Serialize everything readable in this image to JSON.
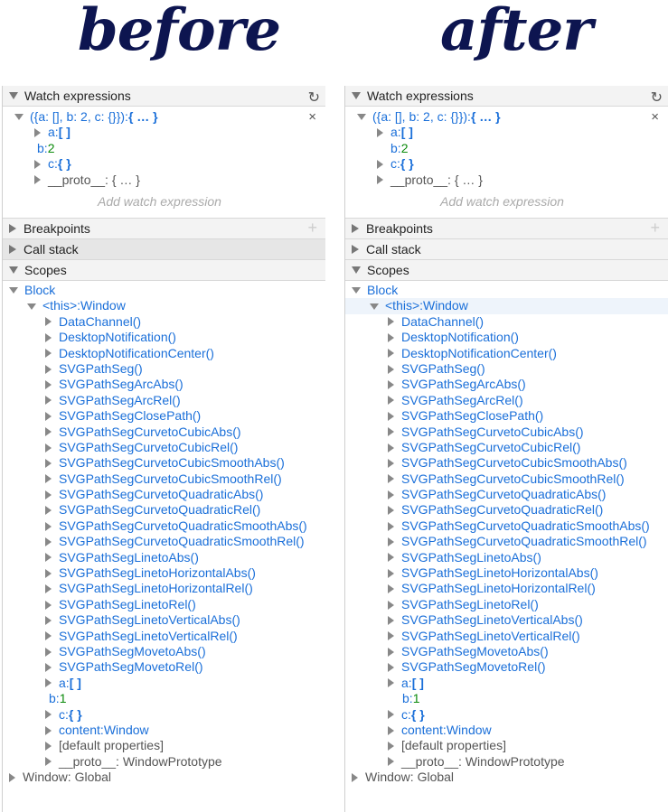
{
  "titles": {
    "before": "before",
    "after": "after"
  },
  "panel": {
    "watch_header": "Watch expressions",
    "breakpoints_header": "Breakpoints",
    "callstack_header": "Call stack",
    "scopes_header": "Scopes",
    "watch": {
      "expr": "({a: [], b: 2, c: {}}): ",
      "expr_value": "{ … }",
      "close": "×",
      "a_key": "a: ",
      "a_val": "[ ]",
      "b_key": "b: ",
      "b_val": "2",
      "c_key": "c: ",
      "c_val": "{ }",
      "proto": "__proto__: { … }",
      "add_placeholder": "Add watch expression"
    },
    "scopes": {
      "block_label": "Block",
      "this_key": "<this>: ",
      "this_val": "Window",
      "functions": [
        "DataChannel()",
        "DesktopNotification()",
        "DesktopNotificationCenter()",
        "SVGPathSeg()",
        "SVGPathSegArcAbs()",
        "SVGPathSegArcRel()",
        "SVGPathSegClosePath()",
        "SVGPathSegCurvetoCubicAbs()",
        "SVGPathSegCurvetoCubicRel()",
        "SVGPathSegCurvetoCubicSmoothAbs()",
        "SVGPathSegCurvetoCubicSmoothRel()",
        "SVGPathSegCurvetoQuadraticAbs()",
        "SVGPathSegCurvetoQuadraticRel()",
        "SVGPathSegCurvetoQuadraticSmoothAbs()",
        "SVGPathSegCurvetoQuadraticSmoothRel()",
        "SVGPathSegLinetoAbs()",
        "SVGPathSegLinetoHorizontalAbs()",
        "SVGPathSegLinetoHorizontalRel()",
        "SVGPathSegLinetoRel()",
        "SVGPathSegLinetoVerticalAbs()",
        "SVGPathSegLinetoVerticalRel()",
        "SVGPathSegMovetoAbs()",
        "SVGPathSegMovetoRel()"
      ],
      "a_key": "a: ",
      "a_val": "[ ]",
      "b_key": "b: ",
      "b_val": "1",
      "c_key": "c: ",
      "c_val": "{ }",
      "content_key": "content: ",
      "content_val": "Window",
      "default_props": "[default properties]",
      "proto": "__proto__: WindowPrototype",
      "window_global": "Window: Global"
    }
  },
  "colors": {
    "title": "#0d1550",
    "link_blue": "#1a6fd9",
    "value_green": "#0a8a0a"
  }
}
